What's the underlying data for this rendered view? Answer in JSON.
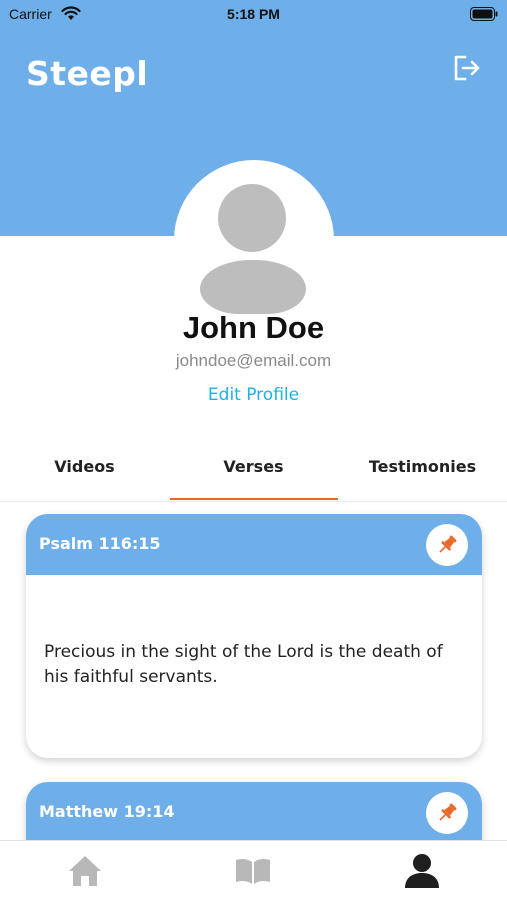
{
  "status_bar": {
    "carrier": "Carrier",
    "time": "5:18 PM"
  },
  "header": {
    "title": "Steepl",
    "logout_icon": "logout-icon",
    "background_color": "#6eaee9"
  },
  "profile": {
    "name": "John Doe",
    "email": "johndoe@email.com",
    "edit_label": "Edit Profile"
  },
  "tabs": [
    {
      "label": "Videos",
      "active": false
    },
    {
      "label": "Verses",
      "active": true
    },
    {
      "label": "Testimonies",
      "active": false
    }
  ],
  "accent_color": "#e8692a",
  "verses": [
    {
      "reference": "Psalm 116:15",
      "text": "Precious in the sight of the Lord is the death of his faithful servants.",
      "pinned": true
    },
    {
      "reference": "Matthew 19:14",
      "text": "",
      "pinned": true
    }
  ],
  "bottom_nav": [
    {
      "icon": "home-icon",
      "active": false
    },
    {
      "icon": "bible-icon",
      "active": false
    },
    {
      "icon": "profile-icon",
      "active": true
    }
  ]
}
